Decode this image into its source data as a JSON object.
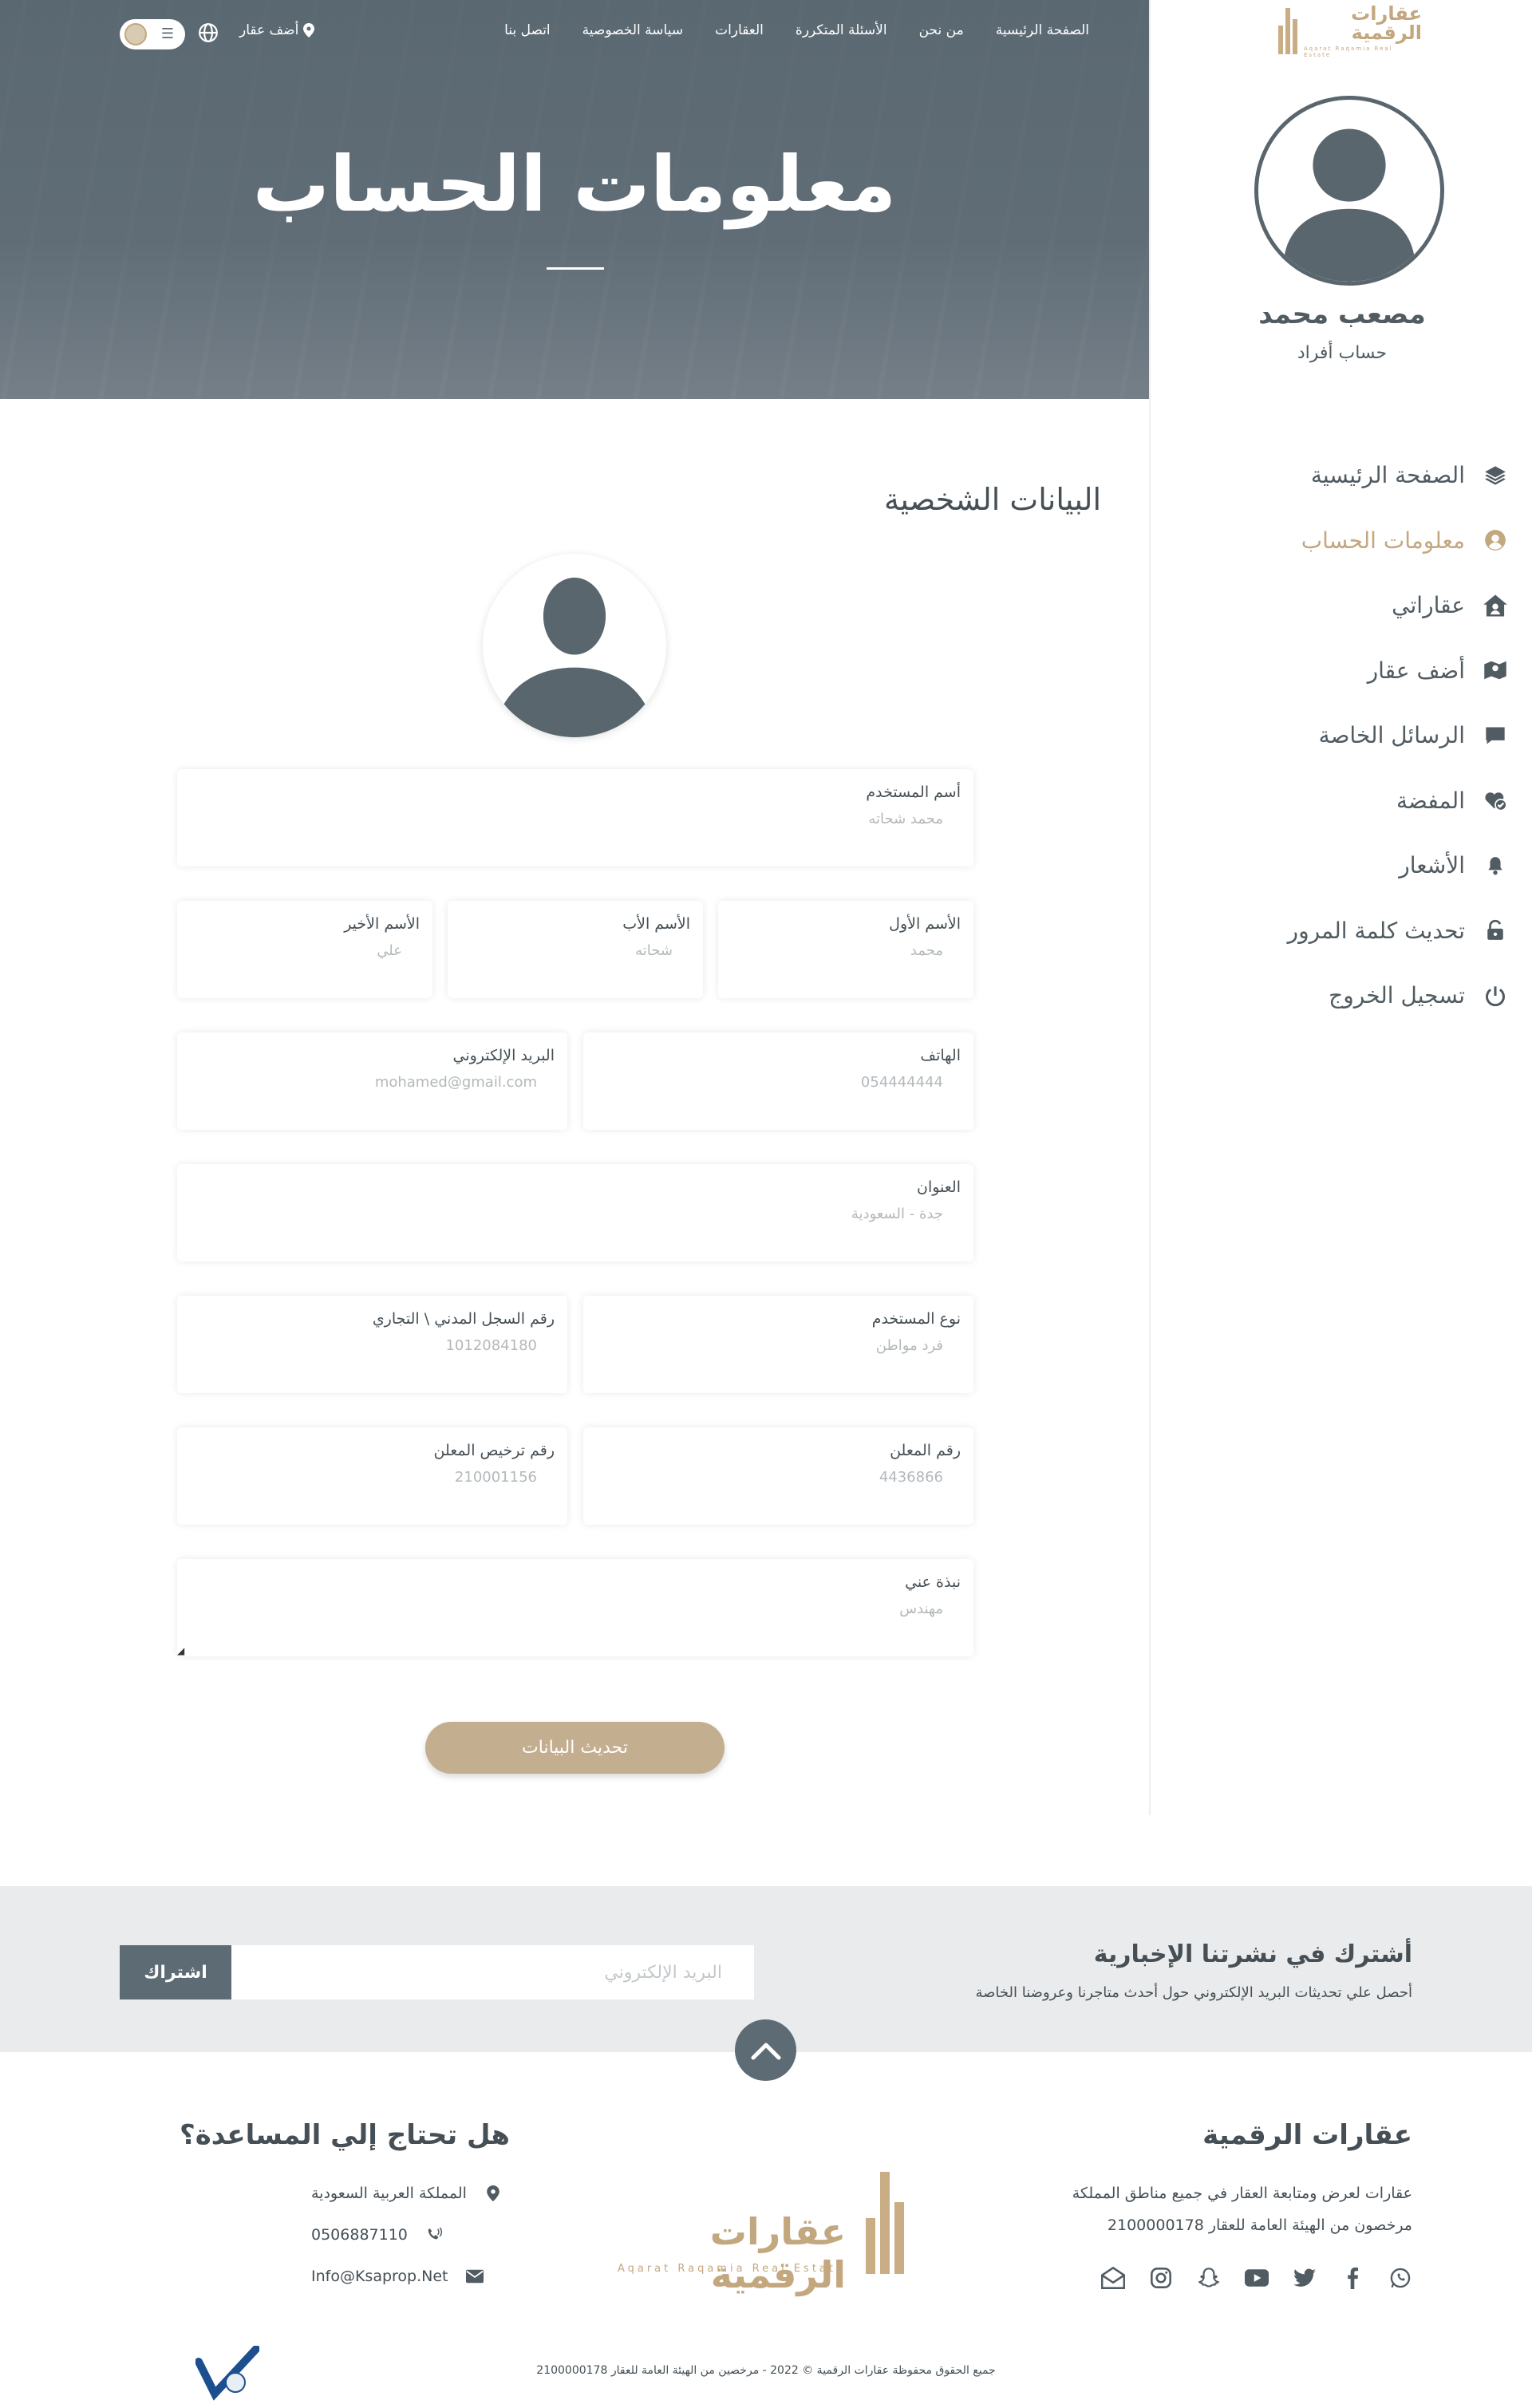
{
  "colors": {
    "accent": "#c3a77e",
    "dark": "#5d6b75",
    "text": "#454f55",
    "muted": "#b3b8bb"
  },
  "brand": {
    "name": "عقارات الرقمية",
    "tagline": "Aqarat Raqamia Real Estate"
  },
  "topnav": {
    "items": [
      "الصفحة الرئيسية",
      "من نحن",
      "الأسئلة المتكررة",
      "العقارات",
      "سياسة الخصوصية",
      "اتصل بنا"
    ],
    "add_property": "أضف عقار",
    "language_icon": "globe-icon",
    "menu_icon": "hamburger-icon"
  },
  "hero": {
    "title": "معلومات الحساب"
  },
  "sidebar": {
    "user_name": "مصعب محمد",
    "account_type": "حساب أفراد",
    "menu": [
      {
        "label": "الصفحة الرئيسية",
        "icon": "layers-icon",
        "active": false
      },
      {
        "label": "معلومات الحساب",
        "icon": "user-circle-icon",
        "active": true
      },
      {
        "label": "عقاراتي",
        "icon": "house-user-icon",
        "active": false
      },
      {
        "label": "أضف عقار",
        "icon": "map-icon",
        "active": false
      },
      {
        "label": "الرسائل الخاصة",
        "icon": "comment-icon",
        "active": false
      },
      {
        "label": "المفضة",
        "icon": "heart-check-icon",
        "active": false
      },
      {
        "label": "الأشعار",
        "icon": "bell-icon",
        "active": false
      },
      {
        "label": "تحديث كلمة المرور",
        "icon": "lock-open-icon",
        "active": false
      },
      {
        "label": "تسجيل الخروج",
        "icon": "power-icon",
        "active": false
      }
    ]
  },
  "profile": {
    "section_title": "البيانات الشخصية",
    "fields": {
      "username": {
        "label": "أسم المستخدم",
        "value": "محمد شحاته"
      },
      "first_name": {
        "label": "الأسم الأول",
        "value": "محمد"
      },
      "father_name": {
        "label": "الأسم الأب",
        "value": "شحاته"
      },
      "last_name": {
        "label": "الأسم الأخير",
        "value": "علي"
      },
      "phone": {
        "label": "الهاتف",
        "value": "054444444"
      },
      "email": {
        "label": "البريد الإلكتروني",
        "value": "mohamed@gmail.com"
      },
      "address": {
        "label": "العنوان",
        "value": "جدة - السعودية"
      },
      "user_type": {
        "label": "نوع المستخدم",
        "value": "فرد مواطن"
      },
      "id_number": {
        "label": "رقم السجل المدني \\ التجاري",
        "value": "1012084180"
      },
      "advertiser_number": {
        "label": "رقم المعلن",
        "value": "4436866"
      },
      "advertiser_license": {
        "label": "رقم ترخيص المعلن",
        "value": "210001156"
      },
      "bio": {
        "label": "نبذة عني",
        "value": "مهندس"
      }
    },
    "submit_label": "تحديث البيانات"
  },
  "newsletter": {
    "title": "أشترك في نشرتنا الإخبارية",
    "subtitle": "أحصل علي تحديثات البريد الإلكتروني حول أحدث متاجرنا وعروضنا الخاصة",
    "placeholder": "البريد الإلكتروني",
    "button": "اشتراك"
  },
  "footer": {
    "about_title": "عقارات الرقمية",
    "about_line1": "عقارات لعرض ومتابعة العقار في جميع مناطق المملكة",
    "about_line2": "مرخصون من الهيئة العامة للعقار 2100000178",
    "help_title": "هل تحتاج إلي المساعدة؟",
    "country": "المملكة العربية السعودية",
    "phone": "0506887110",
    "email": "Info@Ksaprop.Net",
    "socials": [
      "whatsapp-icon",
      "facebook-icon",
      "twitter-icon",
      "youtube-icon",
      "snapchat-icon",
      "instagram-icon",
      "envelope-open-icon"
    ],
    "copyright": "جميع الحقوق محفوظة عقارات الرقمية © 2022 - مرخصين من الهيئة العامة للعقار 2100000178"
  }
}
